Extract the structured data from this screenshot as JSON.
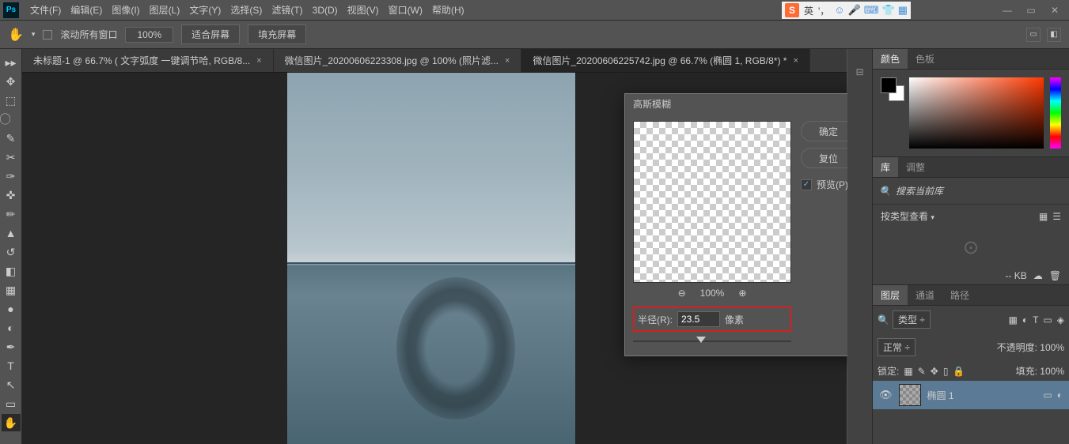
{
  "menu": {
    "items": [
      "文件(F)",
      "编辑(E)",
      "图像(I)",
      "图层(L)",
      "文字(Y)",
      "选择(S)",
      "滤镜(T)",
      "3D(D)",
      "视图(V)",
      "窗口(W)",
      "帮助(H)"
    ]
  },
  "ime": {
    "lang": "英"
  },
  "options": {
    "scroll_all": "滚动所有窗口",
    "zoom": "100%",
    "fit": "适合屏幕",
    "fill": "填充屏幕"
  },
  "tabs": [
    {
      "label": "未标题-1 @ 66.7% ( 文字弧度 一键调节哈, RGB/8...",
      "active": false
    },
    {
      "label": "微信图片_20200606223308.jpg @ 100% (照片滤...",
      "active": false
    },
    {
      "label": "微信图片_20200606225742.jpg @ 66.7% (椭圆 1, RGB/8*) *",
      "active": true
    }
  ],
  "dialog": {
    "title": "高斯模糊",
    "ok": "确定",
    "reset": "复位",
    "preview": "预览(P)",
    "zoom": "100%",
    "radius_label": "半径(R):",
    "radius_value": "23.5",
    "radius_unit": "像素"
  },
  "panels": {
    "color_tab": "颜色",
    "swatch_tab": "色板",
    "lib_tab": "库",
    "adjust_tab": "调整",
    "search_placeholder": "搜索当前库",
    "view_label": "按类型查看",
    "kb": "-- KB",
    "layers_tab": "图层",
    "channels_tab": "通道",
    "paths_tab": "路径",
    "kind": "类型",
    "blend": "正常",
    "opacity_label": "不透明度:",
    "opacity": "100%",
    "lock": "锁定:",
    "fill_label": "填充:",
    "fill": "100%",
    "layer_name": "椭圆 1"
  }
}
